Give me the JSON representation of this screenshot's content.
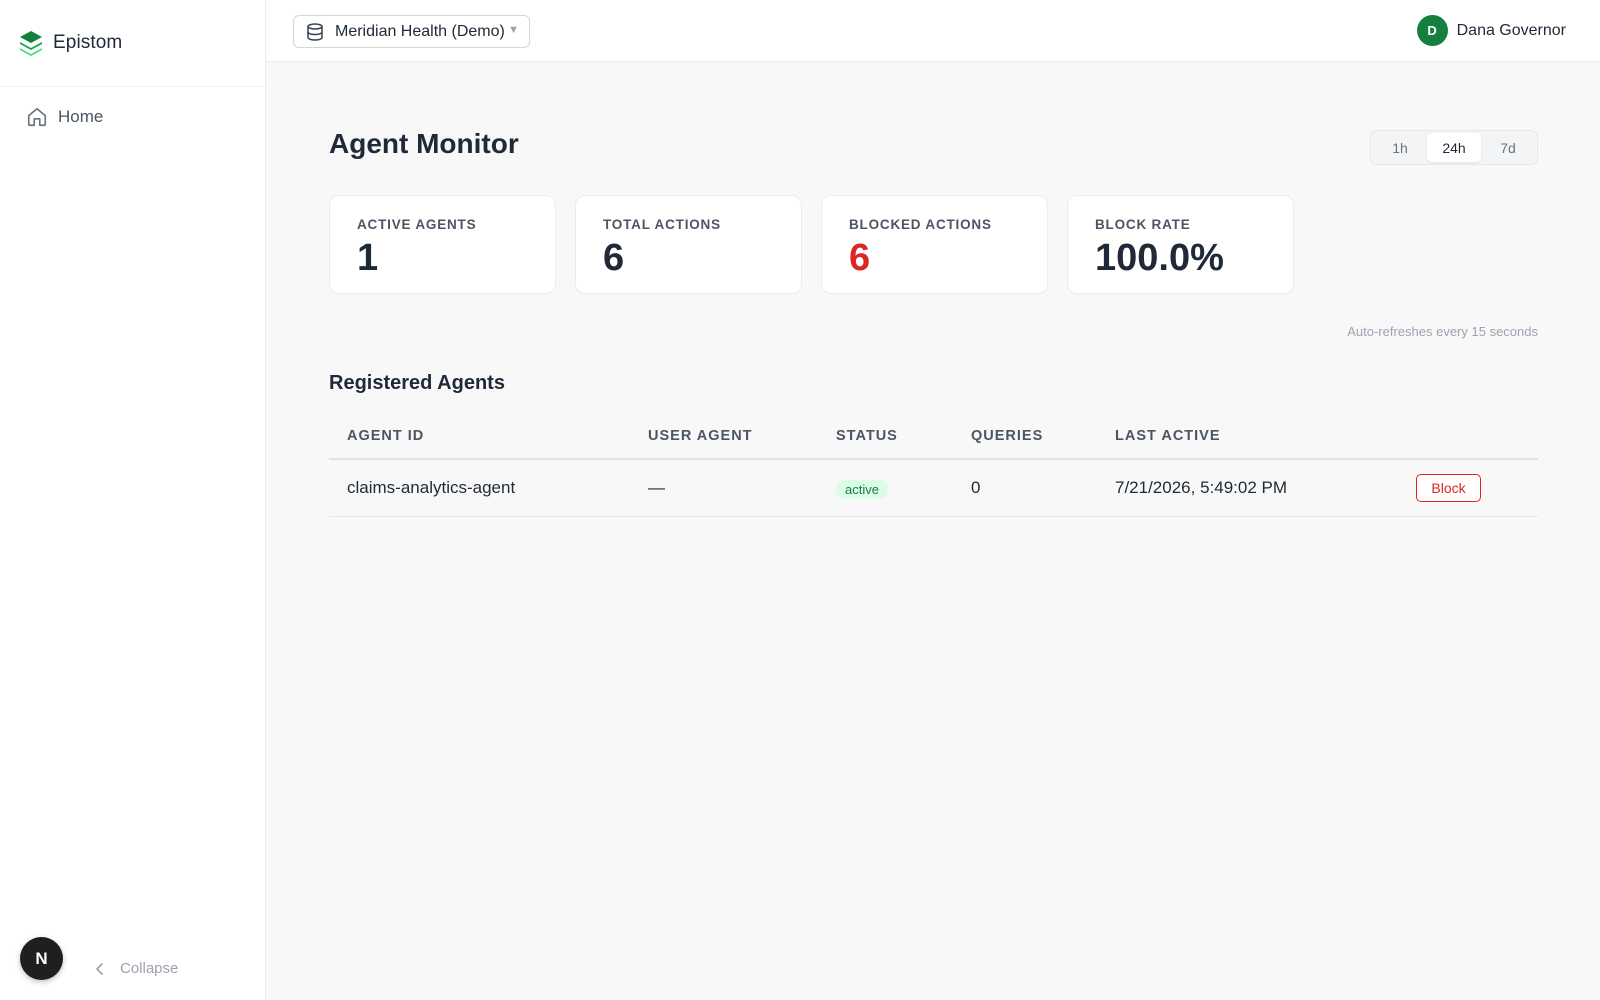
{
  "app": {
    "name": "Epistom",
    "accent": "#15803d",
    "danger": "#dc2626"
  },
  "sidebar": {
    "items": [
      {
        "label": "Home",
        "icon": "home-icon"
      }
    ],
    "collapse_label": "Collapse",
    "badge_letter": "N"
  },
  "topbar": {
    "org_select": {
      "value": "Meridian Health (Demo)",
      "icon": "database-icon"
    },
    "user": {
      "initial": "D",
      "name": "Dana Governor"
    }
  },
  "main": {
    "title": "Agent Monitor",
    "time_ranges": [
      {
        "label": "1h",
        "selected": false
      },
      {
        "label": "24h",
        "selected": true
      },
      {
        "label": "7d",
        "selected": false
      }
    ],
    "stats": [
      {
        "label": "ACTIVE AGENTS",
        "value": "1"
      },
      {
        "label": "TOTAL ACTIONS",
        "value": "6"
      },
      {
        "label": "BLOCKED ACTIONS",
        "value": "6",
        "highlight": "danger"
      },
      {
        "label": "BLOCK RATE",
        "value": "100.0%"
      }
    ],
    "refresh_note": "Auto-refreshes every 15 seconds",
    "agents_section": {
      "title": "Registered Agents",
      "columns": [
        "AGENT ID",
        "USER AGENT",
        "STATUS",
        "QUERIES",
        "LAST ACTIVE"
      ],
      "rows": [
        {
          "agent_id": "claims-analytics-agent",
          "user_agent": "—",
          "status": "active",
          "queries": "0",
          "last_active": "7/21/2026, 5:49:02 PM",
          "action": "Block"
        }
      ]
    }
  }
}
